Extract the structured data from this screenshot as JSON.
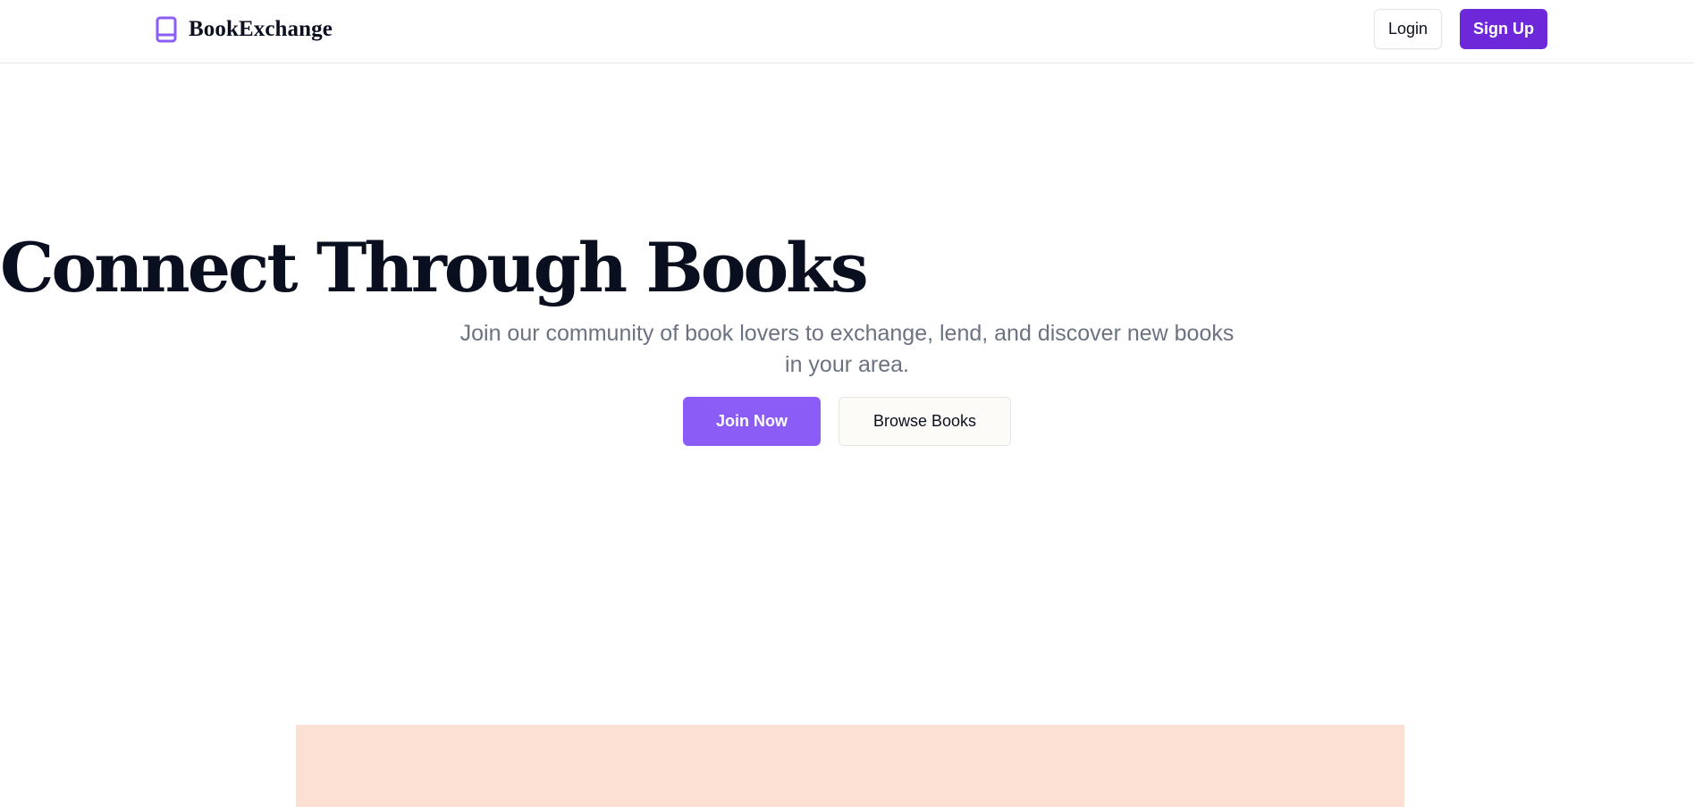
{
  "header": {
    "brand_name": "BookExchange",
    "brand_icon": "book-icon",
    "login_label": "Login",
    "signup_label": "Sign Up"
  },
  "hero": {
    "title": "Connect Through Books",
    "subtitle": "Join our community of book lovers to exchange, lend, and discover new books in your area.",
    "join_label": "Join Now",
    "browse_label": "Browse Books"
  },
  "colors": {
    "accent_primary": "#6d28d9",
    "accent_light": "#8b5cf6",
    "panel_bg": "#fce0d4",
    "text_dark": "#0a0f1f",
    "text_muted": "#6b7280"
  }
}
